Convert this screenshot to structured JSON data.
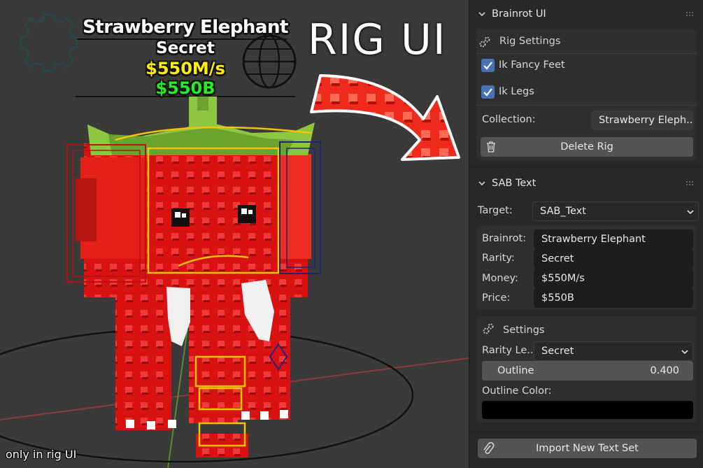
{
  "viewport": {
    "billboard": {
      "name": "Strawberry Elephant",
      "rarity": "Secret",
      "money": "$550M/s",
      "price": "$550B"
    },
    "overlay_title": "RIG UI",
    "corner_note": "only in rig UI"
  },
  "brainrot_ui_panel": {
    "title": "Brainrot UI",
    "rig_settings": {
      "title": "Rig Settings",
      "ik_fancy_feet": {
        "label": "Ik Fancy Feet",
        "checked": true
      },
      "ik_legs": {
        "label": "Ik Legs",
        "checked": true
      },
      "collection_label": "Collection:",
      "collection_value": "Strawberry Eleph...",
      "delete_button": "Delete Rig"
    }
  },
  "sab_text_panel": {
    "title": "SAB Text",
    "target_label": "Target:",
    "target_value": "SAB_Text",
    "brainrot_label": "Brainrot:",
    "brainrot_value": "Strawberry Elephant",
    "rarity_label": "Rarity:",
    "rarity_value": "Secret",
    "money_label": "Money:",
    "money_value": "$550M/s",
    "price_label": "Price:",
    "price_value": "$550B",
    "settings": {
      "title": "Settings",
      "rarity_level_label": "Rarity Le...",
      "rarity_level_value": "Secret",
      "outline_label": "Outline",
      "outline_value": "0.400",
      "outline_color_label": "Outline Color:",
      "outline_color": "#000000"
    },
    "import_button": "Import New Text Set"
  },
  "colors": {
    "panel_bg": "#282828",
    "accent_checkbox": "#4772b3",
    "strawberry_red": "#e01010",
    "leaf_green": "#8ec63f",
    "money_yellow": "#ffee00",
    "price_green": "#22ee22"
  }
}
